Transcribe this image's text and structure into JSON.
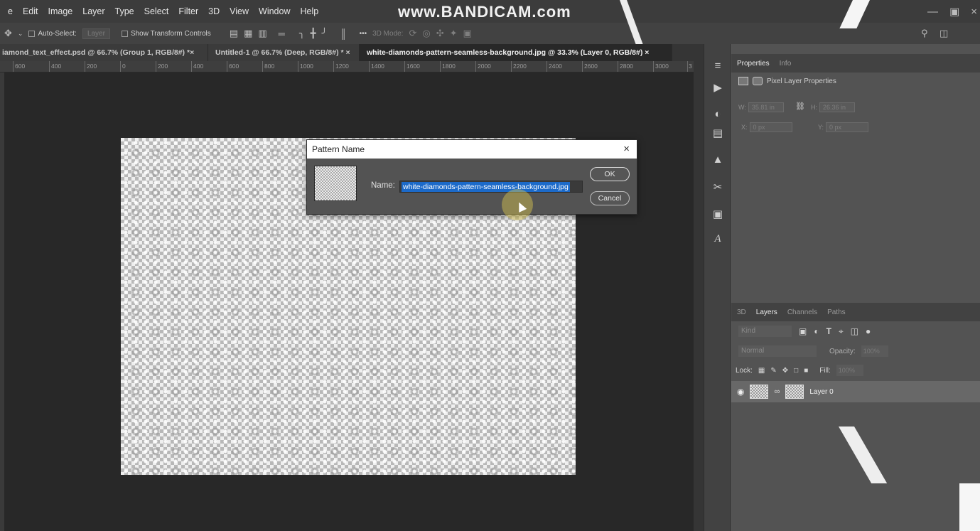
{
  "menu": {
    "items": [
      "e",
      "Edit",
      "Image",
      "Layer",
      "Type",
      "Select",
      "Filter",
      "3D",
      "View",
      "Window",
      "Help"
    ],
    "watermark": "www.BANDICAM.com"
  },
  "options": {
    "auto_select_label": "Auto-Select:",
    "auto_select_value": "Layer",
    "show_transform_label": "Show Transform Controls",
    "more_label": "•••",
    "mode_label": "3D Mode:"
  },
  "tabs": [
    {
      "label": "iamond_text_effect.psd @ 66.7% (Group 1, RGB/8#) *",
      "close": "×"
    },
    {
      "label": "Untitled-1 @ 66.7% (Deep, RGB/8#) *",
      "close": "×"
    },
    {
      "label": "white-diamonds-pattern-seamless-background.jpg @ 33.3% (Layer 0, RGB/8#)",
      "close": "×"
    }
  ],
  "ruler": {
    "ticks": [
      "600",
      "400",
      "200",
      "0",
      "200",
      "400",
      "600",
      "800",
      "1000",
      "1200",
      "1400",
      "1600",
      "1800",
      "2000",
      "2200",
      "2400",
      "2600",
      "2800",
      "3000",
      "3"
    ]
  },
  "dialog": {
    "title": "Pattern Name",
    "close": "×",
    "name_label": "Name:",
    "name_value": "white-diamonds-pattern-seamless-background.jpg",
    "ok_label": "OK",
    "cancel_label": "Cancel"
  },
  "properties": {
    "tab_properties": "Properties",
    "tab_info": "Info",
    "header": "Pixel Layer Properties",
    "w_label": "W:",
    "w_value": "35.81 in",
    "h_label": "H:",
    "h_value": "26.36 in",
    "x_label": "X:",
    "x_value": "0 px",
    "y_label": "Y:",
    "y_value": "0 px",
    "link_icon": "⛓"
  },
  "layers": {
    "tab_3d": "3D",
    "tab_layers": "Layers",
    "tab_channels": "Channels",
    "tab_paths": "Paths",
    "kind_placeholder": "Kind",
    "blend_mode": "Normal",
    "opacity_label": "Opacity:",
    "opacity_value": "100%",
    "lock_label": "Lock:",
    "fill_label": "Fill:",
    "fill_value": "100%",
    "layer_name": "Layer 0"
  },
  "colors": {
    "selection": "#1c6ac9",
    "cursor_highlight": "#dcc850"
  }
}
